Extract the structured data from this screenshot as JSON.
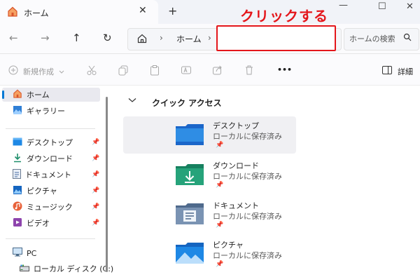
{
  "tab": {
    "title": "ホーム",
    "close": "✕",
    "new_tab": "+"
  },
  "annotation": {
    "text": "クリックする",
    "color": "#e4161b"
  },
  "window_controls": {
    "minimize": "—",
    "maximize": "☐",
    "close": "✕"
  },
  "nav": {
    "back": "←",
    "forward": "→",
    "up": "↑",
    "refresh": "↻"
  },
  "address": {
    "chevron1": "›",
    "segment": "ホーム",
    "chevron2": "›"
  },
  "search": {
    "placeholder": "ホームの検索"
  },
  "toolbar": {
    "new_label": "新規作成",
    "more": "•••",
    "details_label": "詳細"
  },
  "sidebar": {
    "home": "ホーム",
    "gallery": "ギャラリー",
    "desktop": "デスクトップ",
    "downloads": "ダウンロード",
    "documents": "ドキュメント",
    "pictures": "ピクチャ",
    "music": "ミュージック",
    "videos": "ビデオ",
    "pc": "PC",
    "local_disk": "ローカル ディスク (C:)",
    "pin": "📌"
  },
  "quick_access": {
    "title": "クイック アクセス",
    "items": [
      {
        "name": "デスクトップ",
        "status": "ローカルに保存済み"
      },
      {
        "name": "ダウンロード",
        "status": "ローカルに保存済み"
      },
      {
        "name": "ドキュメント",
        "status": "ローカルに保存済み"
      },
      {
        "name": "ピクチャ",
        "status": "ローカルに保存済み"
      }
    ]
  },
  "colors": {
    "accent": "#0078d4",
    "download_green": "#1f8f6b",
    "annotation_red": "#e4161b"
  }
}
